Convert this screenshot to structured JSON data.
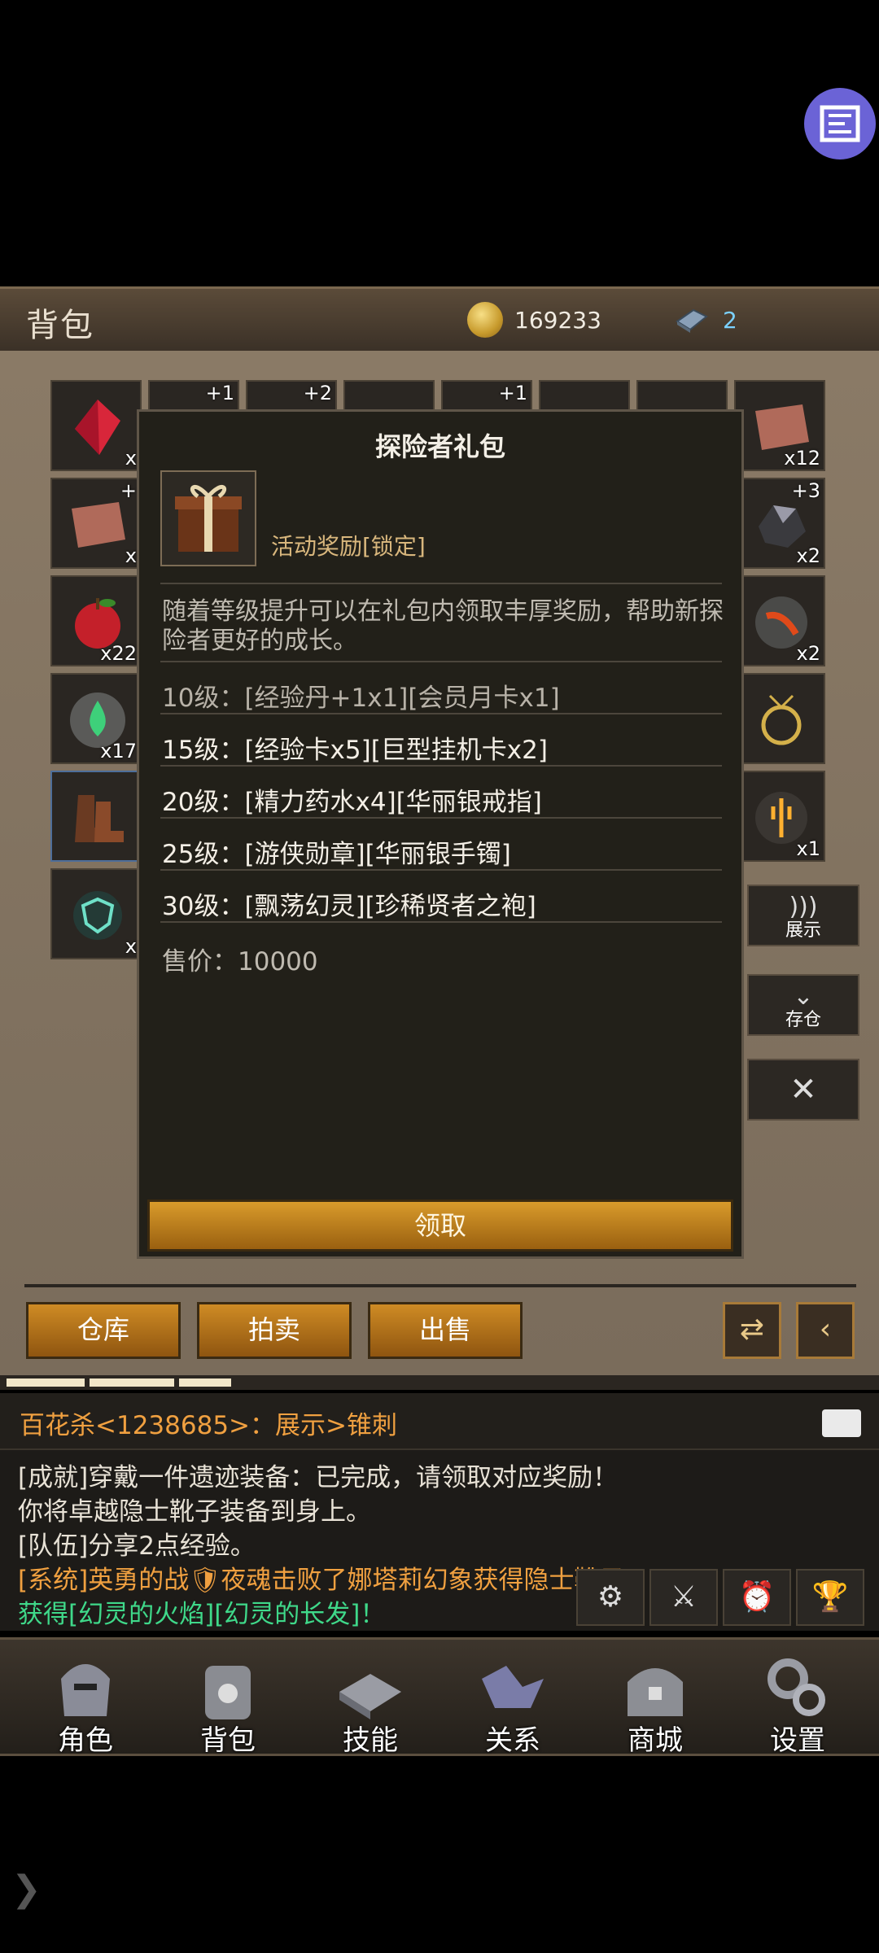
{
  "header": {
    "title": "背包",
    "gold": "169233",
    "gems": "2"
  },
  "inventory": {
    "left_counts": [
      "x",
      "x",
      "x22",
      "x17",
      "",
      "x"
    ],
    "top_plus": [
      "+1",
      "+2",
      "+1"
    ],
    "right_counts": [
      "x12",
      "x2",
      "x2",
      "",
      "x1"
    ],
    "right_plus": [
      "",
      "+3"
    ],
    "left_plus_row2": "+"
  },
  "side_buttons": {
    "display": "展示",
    "store": "存仓",
    "close": "✕"
  },
  "popup": {
    "title": "探险者礼包",
    "tag": "活动奖励[锁定]",
    "description": "随着等级提升可以在礼包内领取丰厚奖励，帮助新探险者更好的成长。",
    "rewards": [
      "10级：[经验丹+1x1][会员月卡x1]",
      "15级：[经验卡x5][巨型挂机卡x2]",
      "20级：[精力药水x4][华丽银戒指]",
      "25级：[游侠勋章][华丽银手镯]",
      "30级：[飘荡幻灵][珍稀贤者之袍]"
    ],
    "price": "售价：10000",
    "claim": "领取"
  },
  "tabs": {
    "warehouse": "仓库",
    "auction": "拍卖",
    "sell": "出售"
  },
  "chat": {
    "top_line": "百花杀<1238685>：展示>锥刺",
    "log": [
      "[成就]穿戴一件遗迹装备：已完成，请领取对应奖励！",
      "你将卓越隐士靴子装备到身上。",
      "[队伍]分享2点经验。",
      "[系统]英勇的战🛡夜魂击败了娜塔莉幻象获得隐士靴子！",
      "获得[幻灵的火焰][幻灵的长发]！"
    ]
  },
  "nav": [
    "角色",
    "背包",
    "技能",
    "关系",
    "商城",
    "设置"
  ],
  "colors": {
    "accent_orange": "#d99b2b",
    "chat_green": "#3fd98a",
    "chat_orange": "#f0a040"
  }
}
